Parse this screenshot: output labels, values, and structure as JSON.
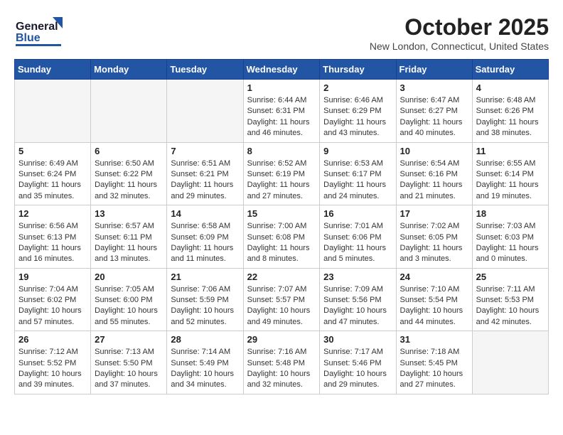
{
  "header": {
    "logo_general": "General",
    "logo_blue": "Blue",
    "month": "October 2025",
    "location": "New London, Connecticut, United States"
  },
  "weekdays": [
    "Sunday",
    "Monday",
    "Tuesday",
    "Wednesday",
    "Thursday",
    "Friday",
    "Saturday"
  ],
  "weeks": [
    [
      {
        "day": "",
        "sunrise": "",
        "sunset": "",
        "daylight": "",
        "empty": true
      },
      {
        "day": "",
        "sunrise": "",
        "sunset": "",
        "daylight": "",
        "empty": true
      },
      {
        "day": "",
        "sunrise": "",
        "sunset": "",
        "daylight": "",
        "empty": true
      },
      {
        "day": "1",
        "sunrise": "Sunrise: 6:44 AM",
        "sunset": "Sunset: 6:31 PM",
        "daylight": "Daylight: 11 hours and 46 minutes.",
        "empty": false
      },
      {
        "day": "2",
        "sunrise": "Sunrise: 6:46 AM",
        "sunset": "Sunset: 6:29 PM",
        "daylight": "Daylight: 11 hours and 43 minutes.",
        "empty": false
      },
      {
        "day": "3",
        "sunrise": "Sunrise: 6:47 AM",
        "sunset": "Sunset: 6:27 PM",
        "daylight": "Daylight: 11 hours and 40 minutes.",
        "empty": false
      },
      {
        "day": "4",
        "sunrise": "Sunrise: 6:48 AM",
        "sunset": "Sunset: 6:26 PM",
        "daylight": "Daylight: 11 hours and 38 minutes.",
        "empty": false
      }
    ],
    [
      {
        "day": "5",
        "sunrise": "Sunrise: 6:49 AM",
        "sunset": "Sunset: 6:24 PM",
        "daylight": "Daylight: 11 hours and 35 minutes.",
        "empty": false
      },
      {
        "day": "6",
        "sunrise": "Sunrise: 6:50 AM",
        "sunset": "Sunset: 6:22 PM",
        "daylight": "Daylight: 11 hours and 32 minutes.",
        "empty": false
      },
      {
        "day": "7",
        "sunrise": "Sunrise: 6:51 AM",
        "sunset": "Sunset: 6:21 PM",
        "daylight": "Daylight: 11 hours and 29 minutes.",
        "empty": false
      },
      {
        "day": "8",
        "sunrise": "Sunrise: 6:52 AM",
        "sunset": "Sunset: 6:19 PM",
        "daylight": "Daylight: 11 hours and 27 minutes.",
        "empty": false
      },
      {
        "day": "9",
        "sunrise": "Sunrise: 6:53 AM",
        "sunset": "Sunset: 6:17 PM",
        "daylight": "Daylight: 11 hours and 24 minutes.",
        "empty": false
      },
      {
        "day": "10",
        "sunrise": "Sunrise: 6:54 AM",
        "sunset": "Sunset: 6:16 PM",
        "daylight": "Daylight: 11 hours and 21 minutes.",
        "empty": false
      },
      {
        "day": "11",
        "sunrise": "Sunrise: 6:55 AM",
        "sunset": "Sunset: 6:14 PM",
        "daylight": "Daylight: 11 hours and 19 minutes.",
        "empty": false
      }
    ],
    [
      {
        "day": "12",
        "sunrise": "Sunrise: 6:56 AM",
        "sunset": "Sunset: 6:13 PM",
        "daylight": "Daylight: 11 hours and 16 minutes.",
        "empty": false
      },
      {
        "day": "13",
        "sunrise": "Sunrise: 6:57 AM",
        "sunset": "Sunset: 6:11 PM",
        "daylight": "Daylight: 11 hours and 13 minutes.",
        "empty": false
      },
      {
        "day": "14",
        "sunrise": "Sunrise: 6:58 AM",
        "sunset": "Sunset: 6:09 PM",
        "daylight": "Daylight: 11 hours and 11 minutes.",
        "empty": false
      },
      {
        "day": "15",
        "sunrise": "Sunrise: 7:00 AM",
        "sunset": "Sunset: 6:08 PM",
        "daylight": "Daylight: 11 hours and 8 minutes.",
        "empty": false
      },
      {
        "day": "16",
        "sunrise": "Sunrise: 7:01 AM",
        "sunset": "Sunset: 6:06 PM",
        "daylight": "Daylight: 11 hours and 5 minutes.",
        "empty": false
      },
      {
        "day": "17",
        "sunrise": "Sunrise: 7:02 AM",
        "sunset": "Sunset: 6:05 PM",
        "daylight": "Daylight: 11 hours and 3 minutes.",
        "empty": false
      },
      {
        "day": "18",
        "sunrise": "Sunrise: 7:03 AM",
        "sunset": "Sunset: 6:03 PM",
        "daylight": "Daylight: 11 hours and 0 minutes.",
        "empty": false
      }
    ],
    [
      {
        "day": "19",
        "sunrise": "Sunrise: 7:04 AM",
        "sunset": "Sunset: 6:02 PM",
        "daylight": "Daylight: 10 hours and 57 minutes.",
        "empty": false
      },
      {
        "day": "20",
        "sunrise": "Sunrise: 7:05 AM",
        "sunset": "Sunset: 6:00 PM",
        "daylight": "Daylight: 10 hours and 55 minutes.",
        "empty": false
      },
      {
        "day": "21",
        "sunrise": "Sunrise: 7:06 AM",
        "sunset": "Sunset: 5:59 PM",
        "daylight": "Daylight: 10 hours and 52 minutes.",
        "empty": false
      },
      {
        "day": "22",
        "sunrise": "Sunrise: 7:07 AM",
        "sunset": "Sunset: 5:57 PM",
        "daylight": "Daylight: 10 hours and 49 minutes.",
        "empty": false
      },
      {
        "day": "23",
        "sunrise": "Sunrise: 7:09 AM",
        "sunset": "Sunset: 5:56 PM",
        "daylight": "Daylight: 10 hours and 47 minutes.",
        "empty": false
      },
      {
        "day": "24",
        "sunrise": "Sunrise: 7:10 AM",
        "sunset": "Sunset: 5:54 PM",
        "daylight": "Daylight: 10 hours and 44 minutes.",
        "empty": false
      },
      {
        "day": "25",
        "sunrise": "Sunrise: 7:11 AM",
        "sunset": "Sunset: 5:53 PM",
        "daylight": "Daylight: 10 hours and 42 minutes.",
        "empty": false
      }
    ],
    [
      {
        "day": "26",
        "sunrise": "Sunrise: 7:12 AM",
        "sunset": "Sunset: 5:52 PM",
        "daylight": "Daylight: 10 hours and 39 minutes.",
        "empty": false
      },
      {
        "day": "27",
        "sunrise": "Sunrise: 7:13 AM",
        "sunset": "Sunset: 5:50 PM",
        "daylight": "Daylight: 10 hours and 37 minutes.",
        "empty": false
      },
      {
        "day": "28",
        "sunrise": "Sunrise: 7:14 AM",
        "sunset": "Sunset: 5:49 PM",
        "daylight": "Daylight: 10 hours and 34 minutes.",
        "empty": false
      },
      {
        "day": "29",
        "sunrise": "Sunrise: 7:16 AM",
        "sunset": "Sunset: 5:48 PM",
        "daylight": "Daylight: 10 hours and 32 minutes.",
        "empty": false
      },
      {
        "day": "30",
        "sunrise": "Sunrise: 7:17 AM",
        "sunset": "Sunset: 5:46 PM",
        "daylight": "Daylight: 10 hours and 29 minutes.",
        "empty": false
      },
      {
        "day": "31",
        "sunrise": "Sunrise: 7:18 AM",
        "sunset": "Sunset: 5:45 PM",
        "daylight": "Daylight: 10 hours and 27 minutes.",
        "empty": false
      },
      {
        "day": "",
        "sunrise": "",
        "sunset": "",
        "daylight": "",
        "empty": true
      }
    ]
  ]
}
